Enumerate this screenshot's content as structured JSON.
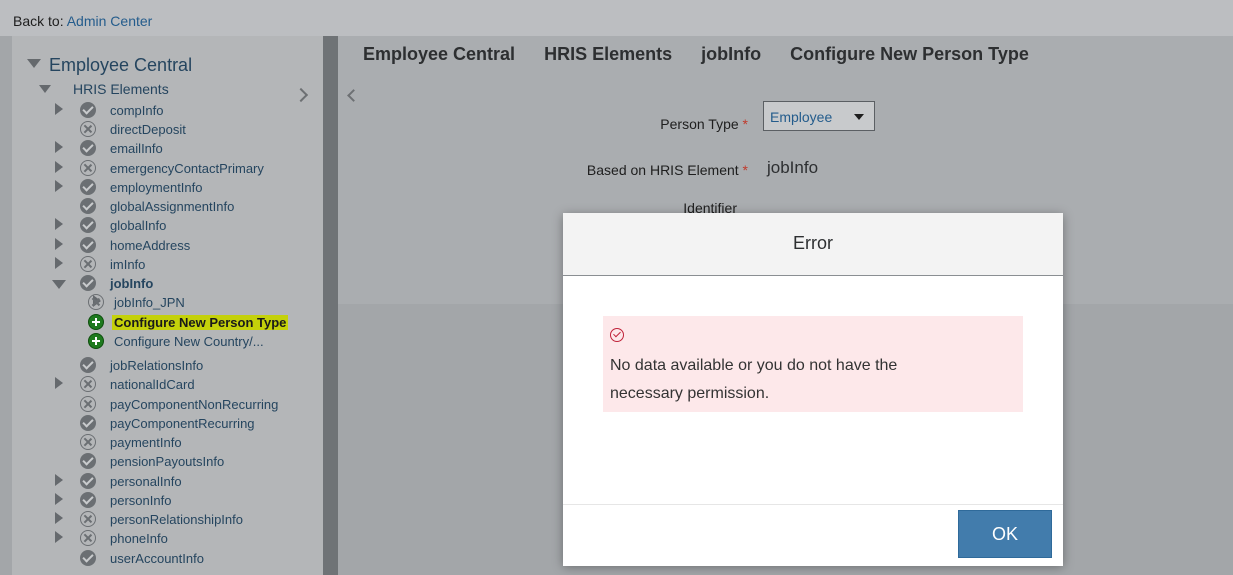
{
  "back": {
    "prefix": "Back to:",
    "link": "Admin Center"
  },
  "tree": {
    "title": "Employee Central",
    "subtitle": "HRIS Elements",
    "items": [
      {
        "label": "compInfo",
        "status": "check",
        "expandable": true
      },
      {
        "label": "directDeposit",
        "status": "x",
        "expandable": false
      },
      {
        "label": "emailInfo",
        "status": "check",
        "expandable": true
      },
      {
        "label": "emergencyContactPrimary",
        "status": "x",
        "expandable": true
      },
      {
        "label": "employmentInfo",
        "status": "check",
        "expandable": true
      },
      {
        "label": "globalAssignmentInfo",
        "status": "check",
        "expandable": false
      },
      {
        "label": "globalInfo",
        "status": "check",
        "expandable": true
      },
      {
        "label": "homeAddress",
        "status": "check",
        "expandable": true
      },
      {
        "label": "imInfo",
        "status": "x",
        "expandable": true
      },
      {
        "label": "jobInfo",
        "status": "check",
        "expandable": true,
        "expanded": true
      },
      {
        "label": "jobInfo_JPN",
        "status": "x",
        "expandable": true
      },
      {
        "label": "Configure New Person Type",
        "status": "plus",
        "highlighted": true
      },
      {
        "label": "Configure New Country/...",
        "status": "plus"
      },
      {
        "label": "jobRelationsInfo",
        "status": "check",
        "expandable": false
      },
      {
        "label": "nationalIdCard",
        "status": "x",
        "expandable": true
      },
      {
        "label": "payComponentNonRecurring",
        "status": "x",
        "expandable": false
      },
      {
        "label": "payComponentRecurring",
        "status": "check",
        "expandable": false
      },
      {
        "label": "paymentInfo",
        "status": "x",
        "expandable": false
      },
      {
        "label": "pensionPayoutsInfo",
        "status": "check",
        "expandable": false
      },
      {
        "label": "personalInfo",
        "status": "check",
        "expandable": true
      },
      {
        "label": "personInfo",
        "status": "check",
        "expandable": true
      },
      {
        "label": "personRelationshipInfo",
        "status": "x",
        "expandable": true
      },
      {
        "label": "phoneInfo",
        "status": "x",
        "expandable": true
      },
      {
        "label": "userAccountInfo",
        "status": "check",
        "expandable": false
      }
    ]
  },
  "breadcrumb": [
    "Employee Central",
    "HRIS Elements",
    "jobInfo",
    "Configure New Person Type"
  ],
  "form": {
    "person_type_label": "Person Type",
    "person_type_value": "Employee",
    "based_label": "Based on HRIS Element",
    "based_value": "jobInfo",
    "identifier_label": "Identifier",
    "required_mark": "*"
  },
  "dialog": {
    "title": "Error",
    "message": "No data available or you do not have the necessary permission.",
    "ok_label": "OK"
  },
  "colors": {
    "highlight": "#c4d10a",
    "ok_button": "#427cac",
    "error_bg": "#fde8ea",
    "add_icon": "#1e7a1e"
  }
}
